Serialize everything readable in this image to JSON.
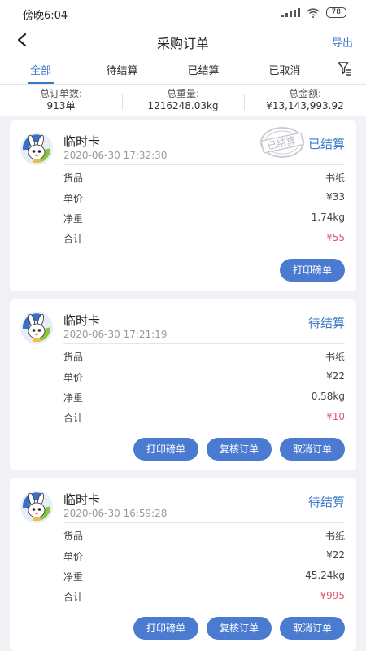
{
  "status_bar": {
    "time": "傍晚6:04",
    "battery": "78"
  },
  "nav": {
    "title": "采购订单",
    "export_label": "导出"
  },
  "tabs": [
    {
      "label": "全部",
      "active": true
    },
    {
      "label": "待结算",
      "active": false
    },
    {
      "label": "已结算",
      "active": false
    },
    {
      "label": "已取消",
      "active": false
    }
  ],
  "summary": [
    {
      "label": "总订单数:",
      "value": "913单"
    },
    {
      "label": "总重量:",
      "value": "1216248.03kg"
    },
    {
      "label": "总金额:",
      "value": "¥13,143,993.92"
    }
  ],
  "stamp_text": "已结算",
  "orders": [
    {
      "title": "临时卡",
      "date": "2020-06-30 17:32:30",
      "status": "已结算",
      "stamped": true,
      "rows": [
        {
          "label": "货品",
          "value": "书纸"
        },
        {
          "label": "单价",
          "value": "¥33"
        },
        {
          "label": "净重",
          "value": "1.74kg"
        },
        {
          "label": "合计",
          "value": "¥55"
        }
      ],
      "buttons": [
        "打印磅单"
      ]
    },
    {
      "title": "临时卡",
      "date": "2020-06-30 17:21:19",
      "status": "待结算",
      "stamped": false,
      "rows": [
        {
          "label": "货品",
          "value": "书纸"
        },
        {
          "label": "单价",
          "value": "¥22"
        },
        {
          "label": "净重",
          "value": "0.58kg"
        },
        {
          "label": "合计",
          "value": "¥10"
        }
      ],
      "buttons": [
        "打印磅单",
        "复核订单",
        "取消订单"
      ]
    },
    {
      "title": "临时卡",
      "date": "2020-06-30 16:59:28",
      "status": "待结算",
      "stamped": false,
      "rows": [
        {
          "label": "货品",
          "value": "书纸"
        },
        {
          "label": "单价",
          "value": "¥22"
        },
        {
          "label": "净重",
          "value": "45.24kg"
        },
        {
          "label": "合计",
          "value": "¥995"
        }
      ],
      "buttons": [
        "打印磅单",
        "复核订单",
        "取消订单"
      ]
    }
  ],
  "colors": {
    "accent": "#3c78c8",
    "button": "#4a7bd0",
    "total": "#e0556a",
    "background": "#f1f2f6"
  },
  "icons": {
    "back": "chevron-left-icon",
    "filter": "filter-icon",
    "avatar": "rabbit-avatar-icon",
    "stamp": "settled-stamp-icon"
  }
}
